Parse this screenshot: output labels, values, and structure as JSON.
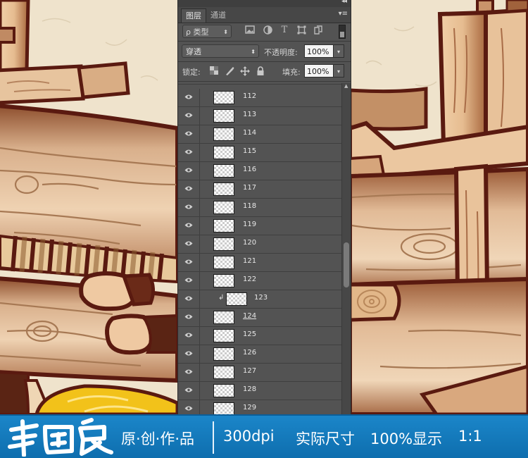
{
  "panel": {
    "tabs": [
      "图层",
      "通道"
    ],
    "collapse_glyph": "◂◂",
    "menu_glyph": "▾≡",
    "filter_kind": "ρ 类型",
    "filter_icons": [
      "image-filter-icon",
      "adjustment-filter-icon",
      "type-filter-icon",
      "shape-filter-icon",
      "smart-object-filter-icon"
    ],
    "blend_mode": "穿透",
    "opacity_label": "不透明度:",
    "opacity_value": "100%",
    "lock_label": "锁定:",
    "lock_icons": [
      "lock-pixels-icon",
      "lock-image-icon",
      "lock-position-icon",
      "lock-all-icon"
    ],
    "fill_label": "填充:",
    "fill_value": "100%"
  },
  "layers": [
    {
      "name": "112",
      "visible": true
    },
    {
      "name": "113",
      "visible": true
    },
    {
      "name": "114",
      "visible": true
    },
    {
      "name": "115",
      "visible": true
    },
    {
      "name": "116",
      "visible": true
    },
    {
      "name": "117",
      "visible": true
    },
    {
      "name": "118",
      "visible": true
    },
    {
      "name": "119",
      "visible": true
    },
    {
      "name": "120",
      "visible": true
    },
    {
      "name": "121",
      "visible": true
    },
    {
      "name": "122",
      "visible": true
    },
    {
      "name": "123",
      "visible": true,
      "clipped": true
    },
    {
      "name": "124",
      "visible": true,
      "underlined": true
    },
    {
      "name": "125",
      "visible": true
    },
    {
      "name": "126",
      "visible": true
    },
    {
      "name": "127",
      "visible": true
    },
    {
      "name": "128",
      "visible": true
    },
    {
      "name": "129",
      "visible": true
    }
  ],
  "banner": {
    "logo_text": "韦国良",
    "works": "原·创·作·品",
    "dpi": "300dpi",
    "actual_size": "实际尺寸",
    "zoom": "100%显示",
    "ratio": "1:1"
  },
  "colors": {
    "outline": "#5a1a10",
    "wood_dark": "#8a4a2a",
    "wood_mid": "#c08a63",
    "wood_light": "#efd2b0",
    "paper": "#efe3cc",
    "banner_blue": "#1580c4",
    "panel_gray": "#535353"
  }
}
